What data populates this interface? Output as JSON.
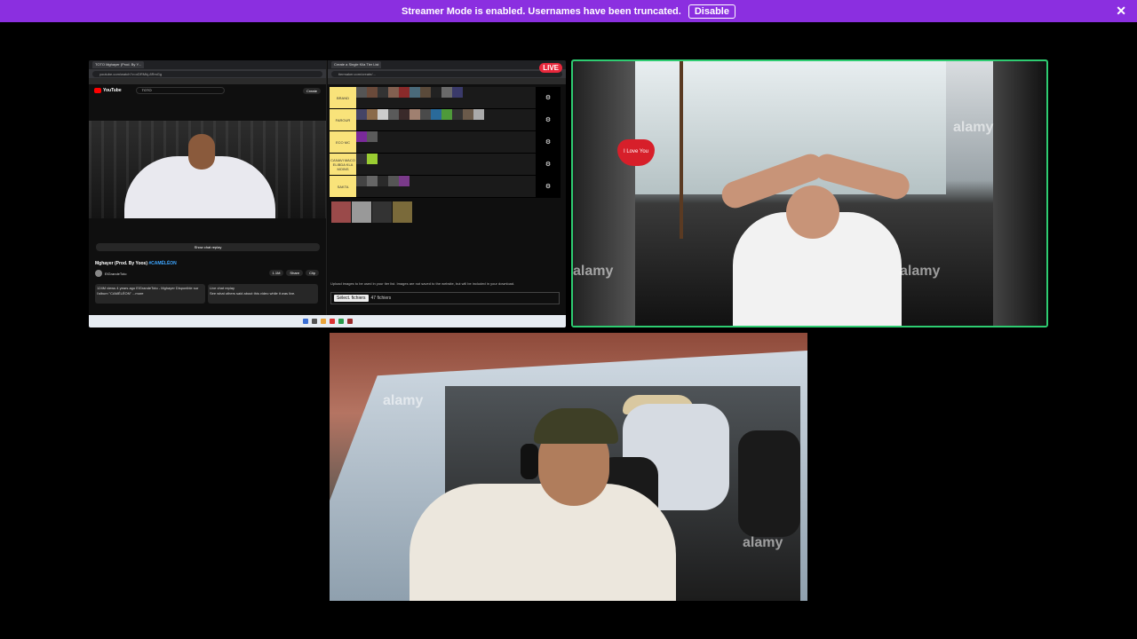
{
  "banner": {
    "message": "Streamer Mode is enabled. Usernames have been truncated.",
    "disable_label": "Disable",
    "close_icon": "close-icon",
    "color": "#8b2fe0"
  },
  "screen_share": {
    "live_badge": "LIVE",
    "youtube": {
      "tab_title": "TOTO Mghayer (Prod. By Y...",
      "url": "youtube.com/watch?v=xDRMkj-8RmGg",
      "search_query": "TOTO",
      "create_label": "Create",
      "show_chat_replay": "Show chat replay",
      "video_title": "Mghayer (Prod. By Yoos)",
      "video_hashtag": "#CAMÉLÉON",
      "channel_name": "ElGrandeToto",
      "channel_subs": "3.1M subscribers",
      "like_count": "1.1M",
      "share_label": "Share",
      "clip_label": "Clip",
      "description": "124M views 4 years ago ElGrandeToto - Mghayer Disponible sur l'album \"CAMÉLÉON\" ...more",
      "live_chat_title": "Live chat replay",
      "live_chat_text": "See what others said about this video while it was live.",
      "open_panel": "Open panel"
    },
    "tierlist": {
      "tab_title": "Create a Single Kila Tier List",
      "url": "tiermaker.com/create/...",
      "tiers": [
        {
          "label": "BRAND",
          "color": "#f9e37a"
        },
        {
          "label": "FAROUR",
          "color": "#f9e37a"
        },
        {
          "label": "ECO MC",
          "color": "#f9e37a"
        },
        {
          "label": "CANAVI MACO ELIBDA KLA MOINS",
          "color": "#f9e37a"
        },
        {
          "label": "SAKTA",
          "color": "#f9e37a"
        }
      ],
      "upload_note": "Upload images to be used in your tier list. Images are not saved to the website, but will be included in your download.",
      "file_button": "Sélect. fichiers",
      "file_count": "47 fichiers"
    }
  },
  "watermark": "alamy",
  "cam1_heart_text": "I Love You",
  "cam1_border_color": "#2ecc71"
}
